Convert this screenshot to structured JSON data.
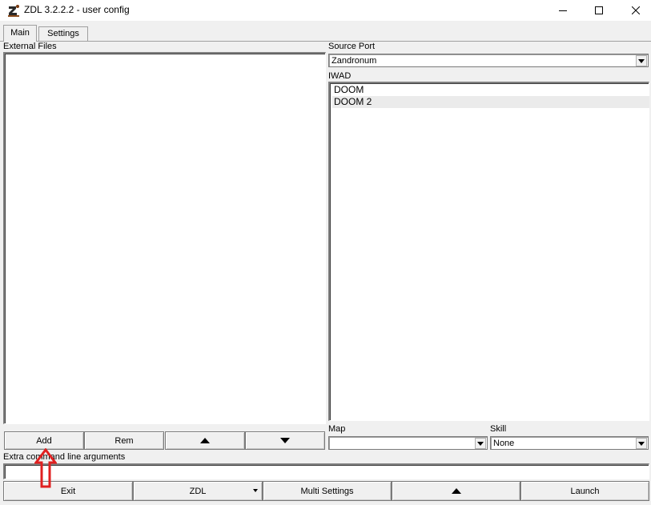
{
  "window": {
    "title": "ZDL 3.2.2.2 - user config",
    "app_icon": "zdl-logo-icon"
  },
  "tabs": [
    {
      "label": "Main",
      "active": true
    },
    {
      "label": "Settings",
      "active": false
    }
  ],
  "external_files": {
    "label": "External Files",
    "items": []
  },
  "source_port": {
    "label": "Source Port",
    "value": "Zandronum"
  },
  "iwad": {
    "label": "IWAD",
    "items": [
      "DOOM",
      "DOOM 2"
    ],
    "selected": "DOOM 2"
  },
  "file_buttons": {
    "add": "Add",
    "rem": "Rem",
    "up_icon": "triangle-up-icon",
    "down_icon": "triangle-down-icon"
  },
  "map": {
    "label": "Map",
    "value": ""
  },
  "skill": {
    "label": "Skill",
    "value": "None"
  },
  "extra_args": {
    "label": "Extra command line arguments",
    "value": ""
  },
  "bottom_buttons": {
    "exit": "Exit",
    "zdl": "ZDL",
    "multi_settings": "Multi Settings",
    "launch": "Launch"
  },
  "annotation": {
    "icon": "red-arrow-up-icon",
    "color": "#e02020"
  }
}
